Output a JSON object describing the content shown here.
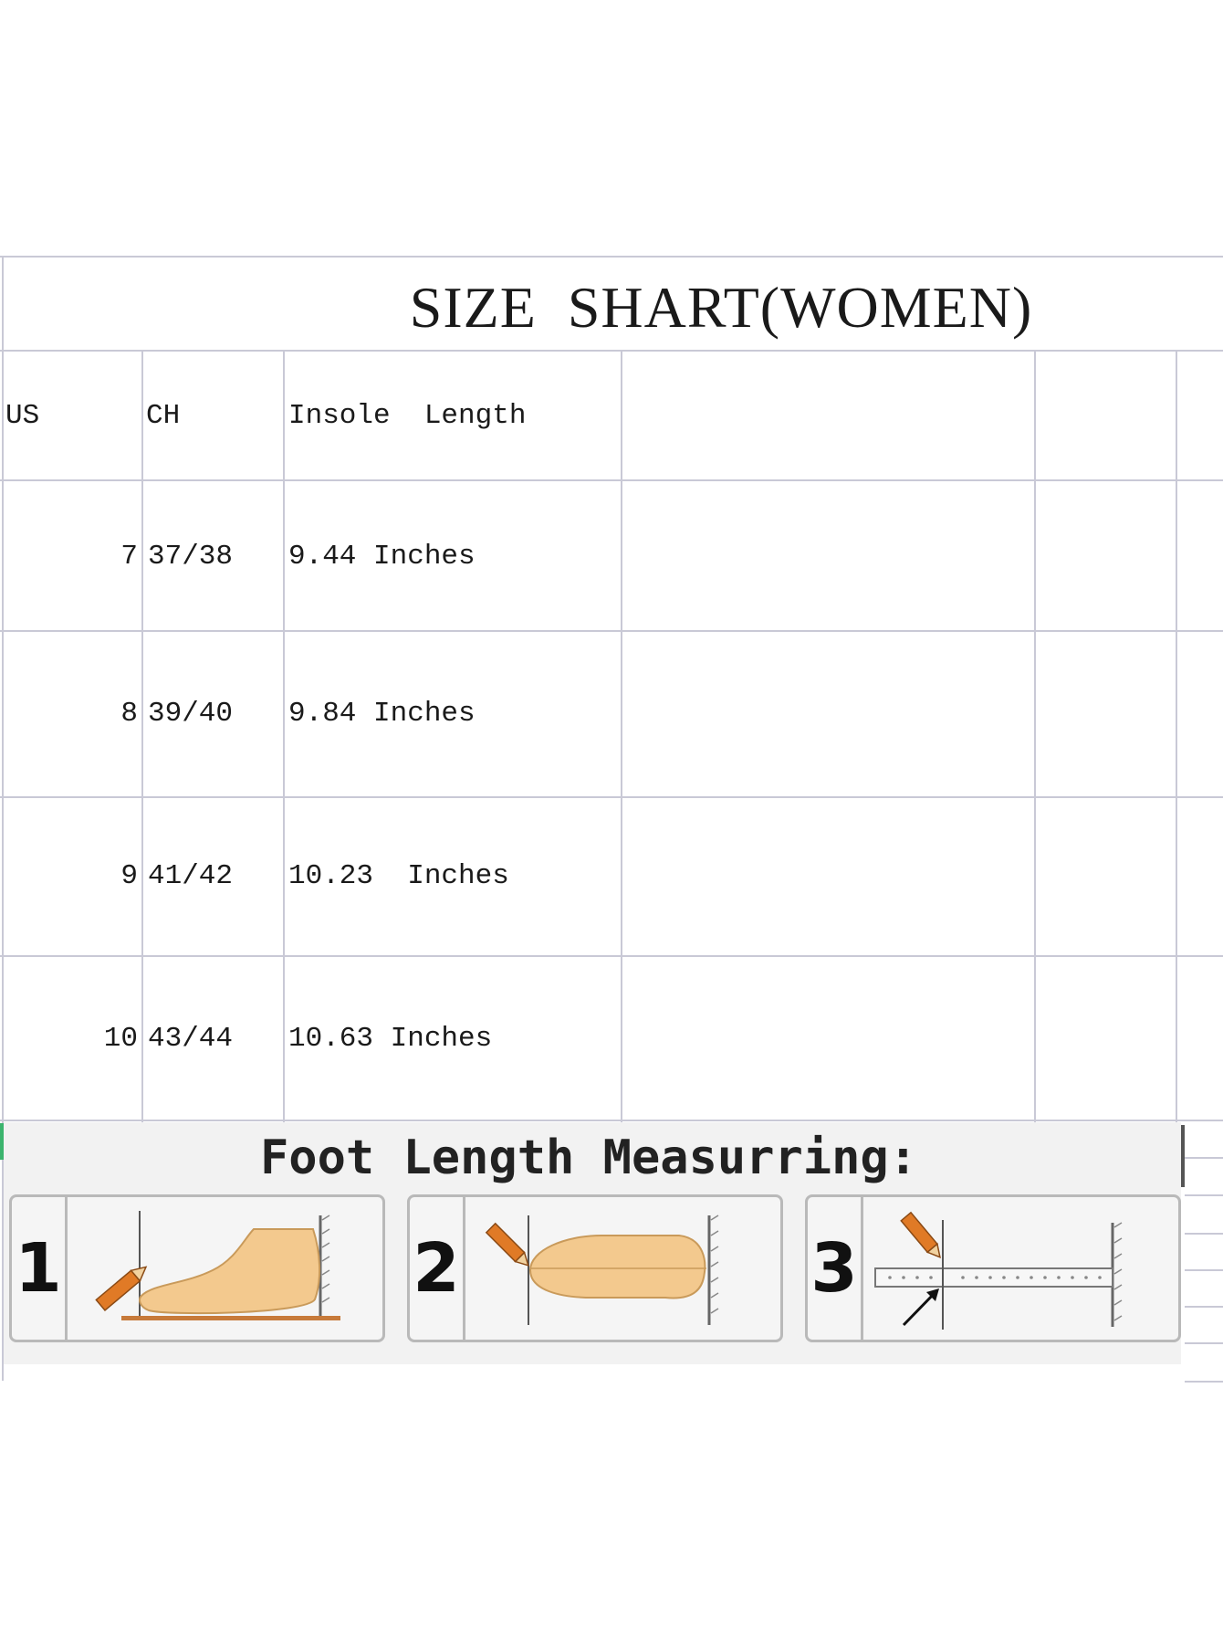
{
  "chart_title": "SIZE  SHART(WOMEN)",
  "table": {
    "headers": [
      "US",
      "CH",
      "Insole  Length"
    ],
    "rows": [
      {
        "us": "7",
        "ch": "37/38",
        "insole": "9.44 Inches"
      },
      {
        "us": "8",
        "ch": "39/40",
        "insole": "9.84 Inches"
      },
      {
        "us": "9",
        "ch": "41/42",
        "insole": "10.23  Inches"
      },
      {
        "us": "10",
        "ch": "43/44",
        "insole": "10.63 Inches"
      }
    ]
  },
  "measuring": {
    "title": "Foot Length Measurring:",
    "steps": [
      {
        "number": "1",
        "icon": "foot-side-pencil-icon"
      },
      {
        "number": "2",
        "icon": "foot-top-pencil-icon"
      },
      {
        "number": "3",
        "icon": "ruler-measure-icon"
      }
    ]
  },
  "colors": {
    "grid": "#c9c9d6",
    "skin": "#f3c98e",
    "pencil": "#e07a26"
  }
}
